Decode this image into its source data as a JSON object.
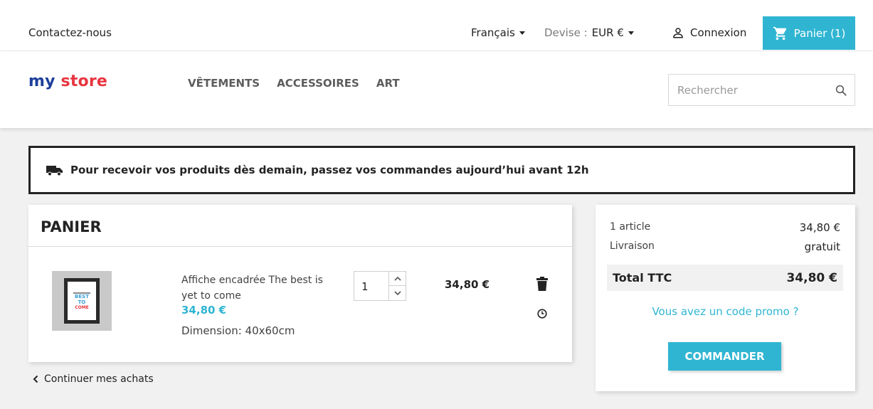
{
  "topbar": {
    "contact": "Contactez-nous",
    "language": "Français",
    "currency_label": "Devise :",
    "currency_value": "EUR €",
    "login": "Connexion",
    "cart": "Panier (1)"
  },
  "header": {
    "logo_part1": "my",
    "logo_part2": "store",
    "menu": [
      "VÊTEMENTS",
      "ACCESSOIRES",
      "ART"
    ],
    "search_placeholder": "Rechercher"
  },
  "banner": {
    "text": "Pour recevoir vos produits dès demain, passez vos commandes aujourd’hui avant 12h"
  },
  "cart": {
    "title": "PANIER",
    "item": {
      "name": "Affiche encadrée The best is yet to come",
      "price": "34,80 €",
      "dimension": "Dimension: 40x60cm",
      "quantity": "1",
      "line_total": "34,80 €",
      "thumb_text_1": "BEST",
      "thumb_text_2": "TO",
      "thumb_text_3": "COME"
    },
    "continue": "Continuer mes achats"
  },
  "summary": {
    "items_label": "1 article",
    "items_value": "34,80 €",
    "shipping_label": "Livraison",
    "shipping_value": "gratuit",
    "total_label": "Total TTC",
    "total_value": "34,80 €",
    "promo": "Vous avez un code promo ?",
    "order_button": "COMMANDER"
  },
  "colors": {
    "accent": "#2fb5d2",
    "logo_blue": "#1d3f9b",
    "logo_red": "#e7353f"
  }
}
